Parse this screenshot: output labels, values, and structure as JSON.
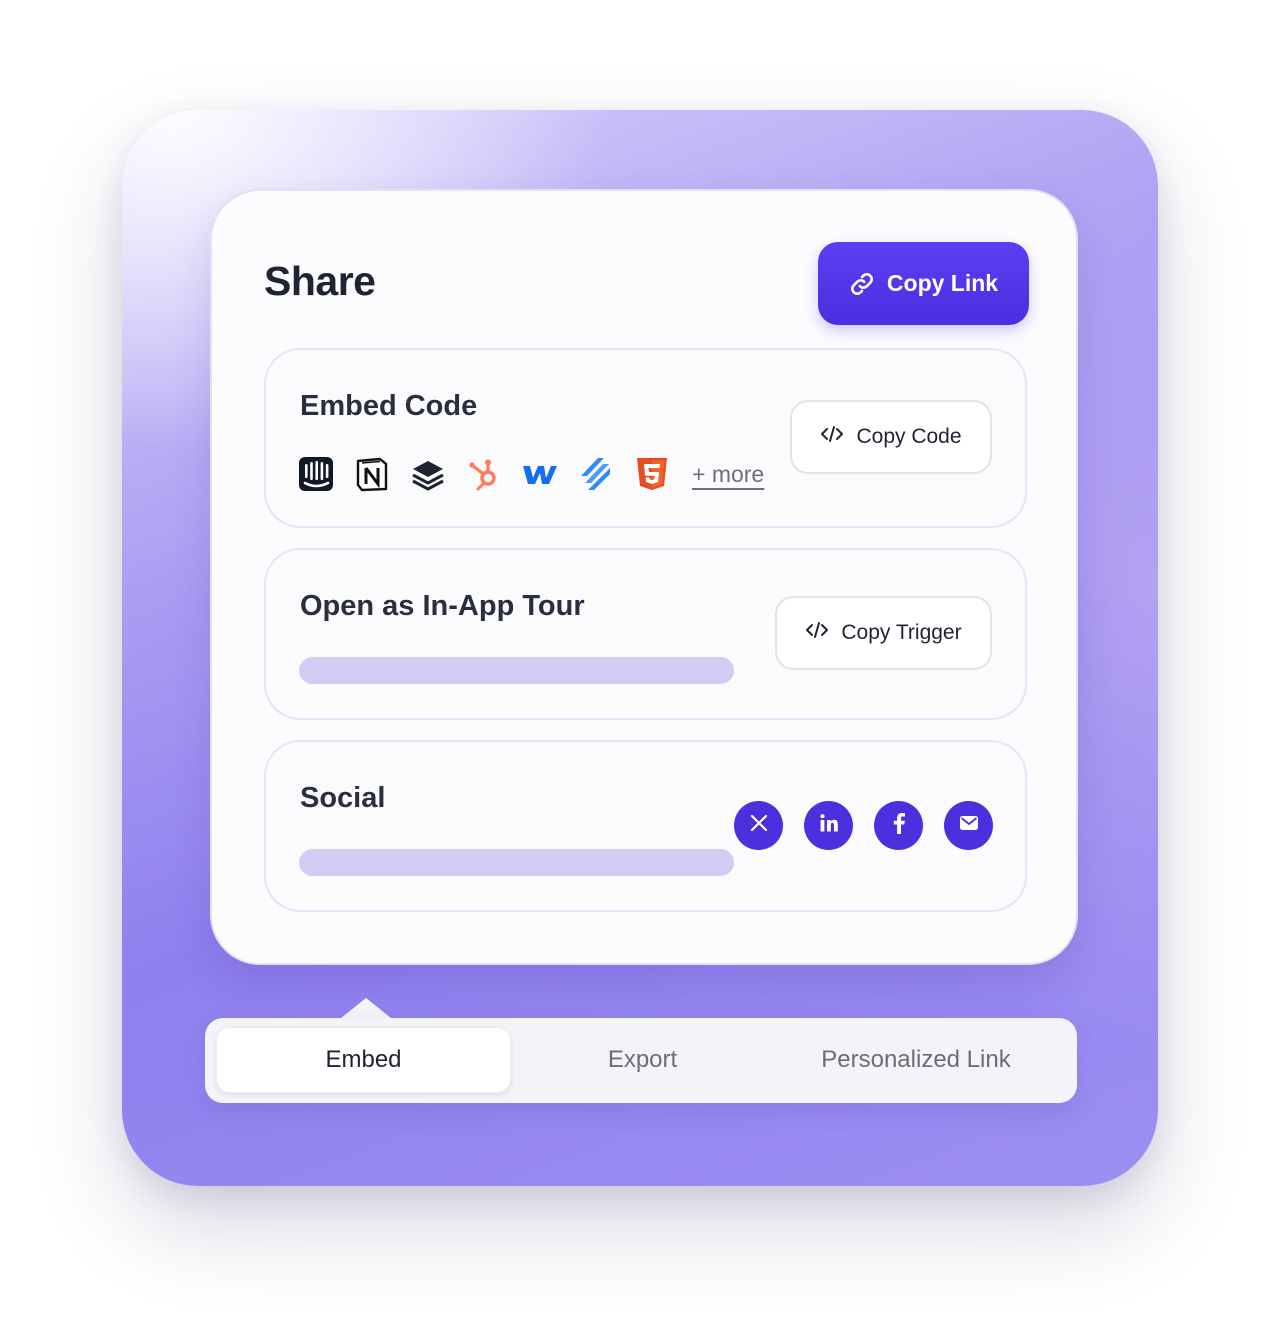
{
  "share": {
    "title": "Share",
    "copy_link_label": "Copy Link"
  },
  "embed_code": {
    "title": "Embed Code",
    "copy_button_label": "Copy Code",
    "more_label": "+ more",
    "logos": [
      "intercom-icon",
      "notion-icon",
      "layers-icon",
      "hubspot-icon",
      "webflow-icon",
      "zendesk-icon",
      "html5-icon"
    ]
  },
  "in_app_tour": {
    "title": "Open as In-App Tour",
    "copy_button_label": "Copy Trigger"
  },
  "social": {
    "title": "Social",
    "buttons": [
      "x-icon",
      "linkedin-icon",
      "facebook-icon",
      "email-icon"
    ]
  },
  "tabs": [
    {
      "label": "Embed",
      "active": true
    },
    {
      "label": "Export",
      "active": false
    },
    {
      "label": "Personalized Link",
      "active": false
    }
  ],
  "colors": {
    "accent": "#4b30de",
    "skeleton": "#d3ccf2",
    "frame": "#8e80ee"
  }
}
